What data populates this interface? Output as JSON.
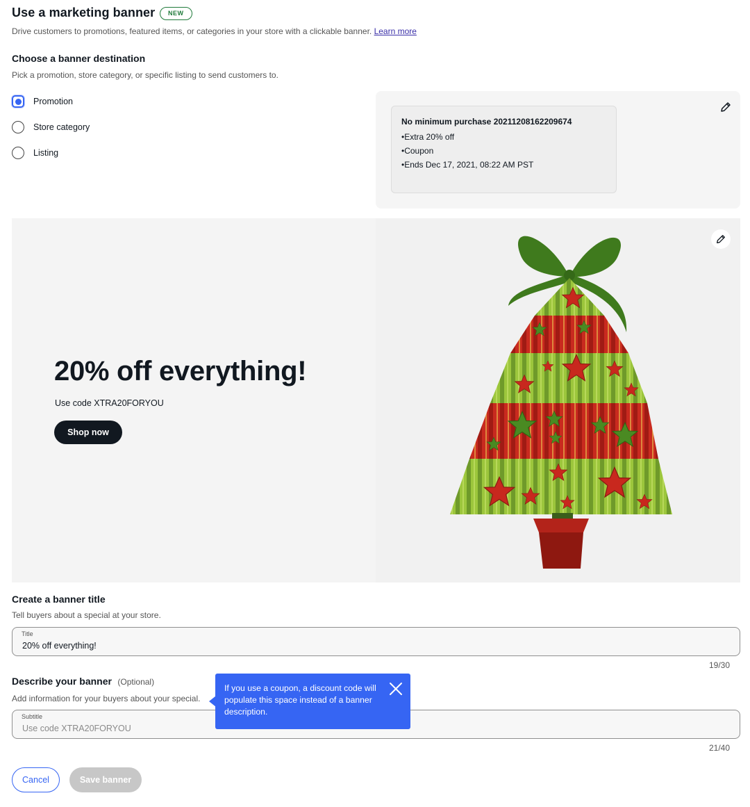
{
  "header": {
    "title": "Use a marketing banner",
    "badge": "NEW",
    "description": "Drive customers to promotions, featured items, or categories in your store with a clickable banner.",
    "learn_more": "Learn more"
  },
  "destination": {
    "title": "Choose a banner destination",
    "description": "Pick a promotion, store category, or specific listing to send customers to.",
    "options": [
      {
        "label": "Promotion",
        "selected": true
      },
      {
        "label": "Store category",
        "selected": false
      },
      {
        "label": "Listing",
        "selected": false
      }
    ]
  },
  "promotion_card": {
    "title": "No minimum purchase 20211208162209674",
    "details": [
      "Extra 20% off",
      "Coupon",
      "Ends Dec 17, 2021, 08:22 AM PST"
    ],
    "edit_icon": "pencil-icon"
  },
  "banner_preview": {
    "headline": "20% off everything!",
    "subtitle": "Use code XTRA20FORYOU",
    "cta": "Shop now",
    "image": "christmas-tree-illustration",
    "edit_icon": "pencil-icon"
  },
  "title_section": {
    "title": "Create a banner title",
    "description": "Tell buyers about a special at your store.",
    "field_label": "Title",
    "value": "20% off everything!",
    "counter": "19/30"
  },
  "description_section": {
    "title": "Describe your banner",
    "optional": "(Optional)",
    "description": "Add information for your buyers about your special.",
    "field_label": "Subtitle",
    "placeholder": "Use code XTRA20FORYOU",
    "counter": "21/40"
  },
  "tooltip": {
    "text": "If you use a coupon, a discount code will populate this space instead of a banner description.",
    "close_icon": "close-icon"
  },
  "actions": {
    "cancel": "Cancel",
    "save": "Save banner"
  },
  "colors": {
    "accent": "#3665f3",
    "dark": "#111820",
    "badge": "#1f7a3a",
    "tree_green": "#8fb83a",
    "tree_red": "#c8281e"
  }
}
